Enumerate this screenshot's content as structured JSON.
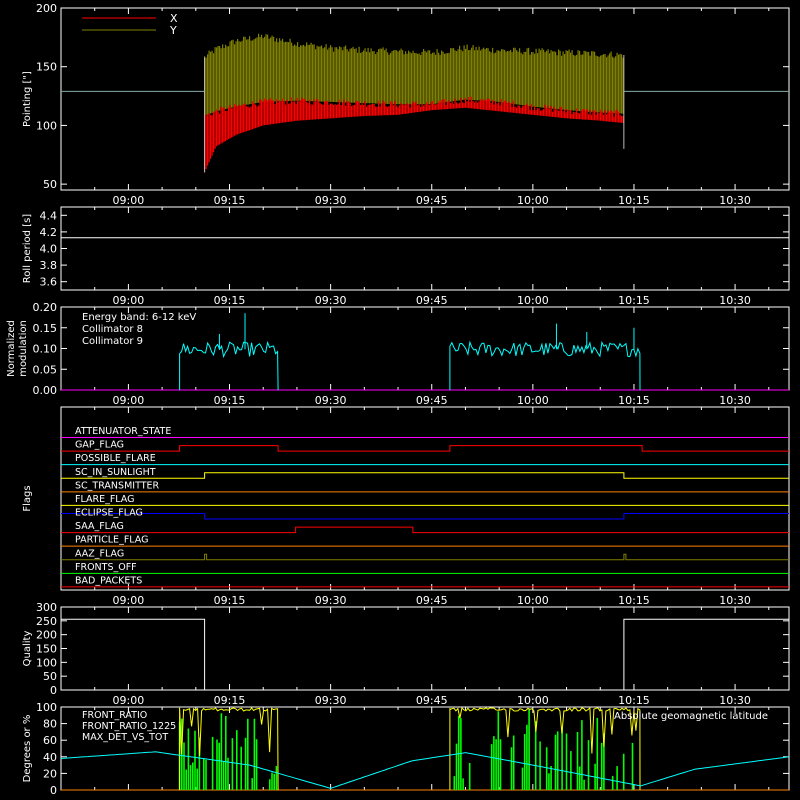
{
  "colors": {
    "background": "#000000",
    "axes": "#ffffff",
    "x_red": "#ff0000",
    "y_olive": "#808000",
    "cyan": "#00ffff",
    "magenta": "#ff00ff",
    "white": "#ffffff",
    "yellow": "#ffff00",
    "green": "#00ff00",
    "orange": "#ff8000",
    "blue": "#0000ff"
  },
  "time_axis": {
    "ticks": [
      "09:00",
      "09:15",
      "09:30",
      "09:45",
      "10:00",
      "10:15",
      "10:30"
    ],
    "tick_minutes": [
      540,
      555,
      570,
      585,
      600,
      615,
      630
    ],
    "range_minutes": [
      530,
      638
    ]
  },
  "chart_data": [
    {
      "id": "pointing",
      "type": "line",
      "ylabel": "Pointing [\"]",
      "ylim": [
        45,
        200
      ],
      "yticks": [
        50,
        100,
        150,
        200
      ],
      "legend": [
        "X",
        "Y"
      ],
      "legend_placement": "top-left",
      "series": [
        {
          "name": "X",
          "color": "#ff0000",
          "band_time": [
            551.3,
            553,
            556,
            560,
            565,
            570,
            575,
            580,
            585,
            590,
            595,
            600,
            605,
            610,
            613.5
          ],
          "band_low": [
            60,
            82,
            92,
            100,
            104,
            106,
            108,
            109,
            113,
            115,
            112,
            109,
            106,
            104,
            102
          ],
          "band_high": [
            108,
            112,
            116,
            120,
            121,
            120,
            119,
            118,
            118,
            122,
            120,
            116,
            113,
            111,
            110
          ]
        },
        {
          "name": "Y",
          "color": "#808000",
          "band_time": [
            551.3,
            553,
            556,
            560,
            565,
            570,
            575,
            580,
            585,
            590,
            595,
            600,
            605,
            610,
            613.5
          ],
          "band_low": [
            108,
            112,
            116,
            120,
            121,
            120,
            119,
            118,
            118,
            122,
            120,
            116,
            113,
            111,
            110
          ],
          "band_high": [
            158,
            165,
            172,
            176,
            170,
            166,
            164,
            163,
            162,
            166,
            164,
            163,
            162,
            161,
            160
          ]
        }
      ],
      "outside_value": 129
    },
    {
      "id": "roll_period",
      "type": "line",
      "ylabel": "Roll period [s]",
      "ylim": [
        3.5,
        4.5
      ],
      "yticks": [
        "3.6",
        "3.8",
        "4.0",
        "4.2",
        "4.4"
      ],
      "ytick_values": [
        3.6,
        3.8,
        4.0,
        4.2,
        4.4
      ],
      "value": 4.13
    },
    {
      "id": "modulation",
      "type": "line",
      "ylabel_lines": [
        "Normalized",
        "modulation"
      ],
      "ylim": [
        0,
        0.2
      ],
      "yticks": [
        "0.00",
        "0.05",
        "0.10",
        "0.15",
        "0.20"
      ],
      "ytick_values": [
        0,
        0.05,
        0.1,
        0.15,
        0.2
      ],
      "legend": [
        "Energy band: 6-12 keV",
        "Collimator 8",
        "Collimator 9"
      ],
      "legend_placement": "top-left",
      "series": [
        {
          "name": "Collimator 8",
          "color": "#00ffff",
          "segments": [
            [
              547.6,
              562.2
            ],
            [
              587.7,
              615.9
            ]
          ],
          "level": 0.098,
          "spikes": [
            [
              557.3,
              0.185
            ],
            [
              553.5,
              0.135
            ],
            [
              603.5,
              0.16
            ],
            [
              615,
              0.15
            ],
            [
              608,
              0.14
            ]
          ]
        },
        {
          "name": "Collimator 9",
          "color": "#ff00ff",
          "level": 0
        }
      ]
    },
    {
      "id": "flags",
      "type": "line",
      "ylabel": "Flags",
      "flags": [
        {
          "name": "ATTENUATOR_STATE",
          "color": "#ff00ff",
          "transitions": [],
          "initial": 0
        },
        {
          "name": "SAA_FLAG",
          "color": "#ff0000",
          "transitions": [
            547.6,
            562.2,
            587.7,
            616.2
          ],
          "initial": 0,
          "label": "GAP_FLAG"
        },
        {
          "name": "POSSIBLE_FLARE",
          "color": "#00ffff",
          "transitions": [],
          "initial": 0
        },
        {
          "name": "SC_IN_SUNLIGHT",
          "color": "#ffff00",
          "transitions": [
            551.3,
            613.5
          ],
          "initial": 0
        },
        {
          "name": "SC_TRANSMITTER",
          "color": "#ff8000",
          "transitions": [],
          "initial": 0
        },
        {
          "name": "FLARE_FLAG",
          "color": "#ffff00",
          "transitions": [],
          "initial": 0
        },
        {
          "name": "ECLIPSE_FLAG",
          "color": "#0000ff",
          "transitions": [
            551.3,
            613.5
          ],
          "initial": 1
        },
        {
          "name": "SAA_FLAG",
          "color": "#ff0000",
          "transitions": [
            564.8,
            582.2
          ],
          "initial": 0
        },
        {
          "name": "PARTICLE_FLAG",
          "color": "#ff8000",
          "transitions": [],
          "initial": 0
        },
        {
          "name": "AAZ_FLAG",
          "color": "#808000",
          "transitions": [
            551.3,
            551.6,
            613.5,
            613.8
          ],
          "initial": 0
        },
        {
          "name": "FRONTS_OFF",
          "color": "#00ff00",
          "transitions": [],
          "initial": 0
        },
        {
          "name": "BAD_PACKETS",
          "color": "#ff0000",
          "transitions": [],
          "initial": 0
        }
      ],
      "flag_labels": [
        "ATTENUATOR_STATE",
        "GAP_FLAG",
        "POSSIBLE_FLARE",
        "SC_IN_SUNLIGHT",
        "SC_TRANSMITTER",
        "FLARE_FLAG",
        "ECLIPSE_FLAG",
        "SAA_FLAG",
        "PARTICLE_FLAG",
        "AAZ_FLAG",
        "FRONTS_OFF",
        "BAD_PACKETS"
      ]
    },
    {
      "id": "quality",
      "type": "line",
      "ylabel": "Quality",
      "ylim": [
        0,
        300
      ],
      "yticks": [
        "0",
        "50",
        "100",
        "150",
        "200",
        "250",
        "300"
      ],
      "ytick_values": [
        0,
        50,
        100,
        150,
        200,
        250,
        300
      ],
      "x": [
        530,
        551.3,
        551.3,
        613.5,
        613.5,
        638
      ],
      "values": [
        256,
        256,
        0,
        0,
        256,
        256
      ]
    },
    {
      "id": "ratios",
      "type": "line",
      "ylabel": "Degrees or %",
      "ylim": [
        0,
        100
      ],
      "yticks": [
        "0",
        "20",
        "40",
        "60",
        "80",
        "100"
      ],
      "ytick_values": [
        0,
        20,
        40,
        60,
        80,
        100
      ],
      "legend": [
        "FRONT_RATIO",
        "FRONT_RATIO_1225",
        "MAX_DET_VS_TOT"
      ],
      "legend_placement": "top-left",
      "annotation": "Absolute geomagnetic latitude",
      "series": [
        {
          "name": "FRONT_RATIO",
          "color": "#ffff00",
          "segments": [
            [
              547.6,
              562.2
            ],
            [
              587.7,
              615.9
            ]
          ],
          "level": 99
        },
        {
          "name": "FRONT_RATIO_1225",
          "color": "#00ff00",
          "segments": [
            [
              547.6,
              562.2
            ],
            [
              587.7,
              615.9
            ]
          ]
        },
        {
          "name": "MAX_DET_VS_TOT",
          "color": "#ff8000",
          "level": 0
        },
        {
          "name": "Absolute geomagnetic latitude",
          "color": "#00ffff",
          "x": [
            530,
            544,
            558,
            570,
            582,
            590,
            600,
            616,
            624,
            638
          ],
          "values": [
            38,
            46,
            30,
            2,
            35,
            45,
            30,
            5,
            25,
            40
          ]
        }
      ]
    }
  ]
}
